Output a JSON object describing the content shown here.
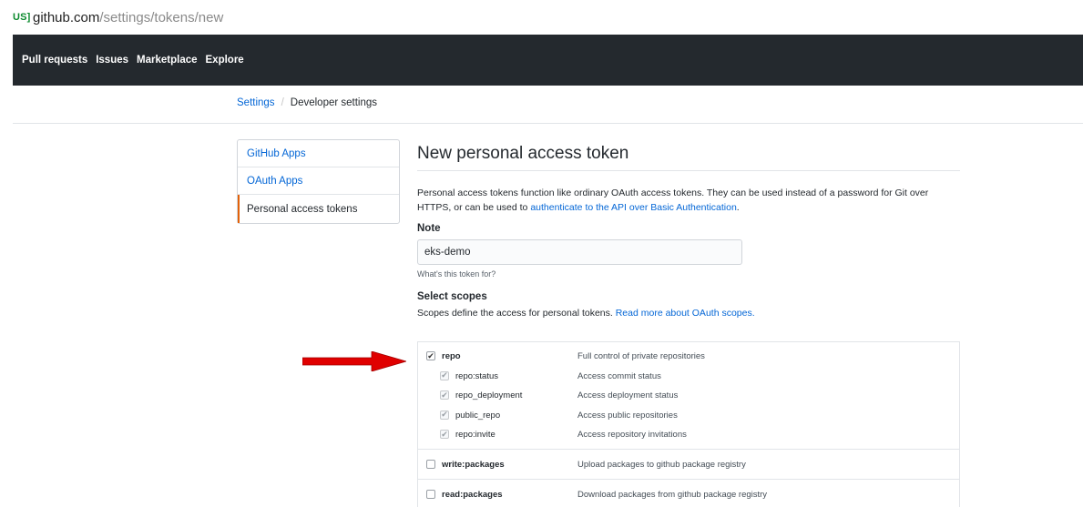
{
  "browser": {
    "secure_badge": "US]",
    "url_domain": "github.com",
    "url_path": "/settings/tokens/new"
  },
  "header": {
    "nav": [
      "Pull requests",
      "Issues",
      "Marketplace",
      "Explore"
    ]
  },
  "breadcrumb": {
    "settings": "Settings",
    "separator": "/",
    "current": "Developer settings"
  },
  "sidebar": {
    "items": [
      {
        "label": "GitHub Apps",
        "active": false
      },
      {
        "label": "OAuth Apps",
        "active": false
      },
      {
        "label": "Personal access tokens",
        "active": true
      }
    ]
  },
  "main": {
    "title": "New personal access token",
    "intro_text": "Personal access tokens function like ordinary OAuth access tokens. They can be used instead of a password for Git over HTTPS, or can be used to ",
    "intro_link": "authenticate to the API over Basic Authentication",
    "intro_end": ".",
    "note_label": "Note",
    "note_value": "eks-demo",
    "note_hint": "What's this token for?",
    "scopes_label": "Select scopes",
    "scopes_desc": "Scopes define the access for personal tokens. ",
    "scopes_link": "Read more about OAuth scopes."
  },
  "scopes": {
    "repo": {
      "name": "repo",
      "desc": "Full control of private repositories",
      "checked": true
    },
    "repo_children": [
      {
        "name": "repo:status",
        "desc": "Access commit status",
        "checked": true
      },
      {
        "name": "repo_deployment",
        "desc": "Access deployment status",
        "checked": true
      },
      {
        "name": "public_repo",
        "desc": "Access public repositories",
        "checked": true
      },
      {
        "name": "repo:invite",
        "desc": "Access repository invitations",
        "checked": true
      }
    ],
    "write_packages": {
      "name": "write:packages",
      "desc": "Upload packages to github package registry",
      "checked": false
    },
    "read_packages": {
      "name": "read:packages",
      "desc": "Download packages from github package registry",
      "checked": false
    }
  },
  "colors": {
    "header_bg": "#24292e",
    "link": "#0366d6",
    "active_menu_accent": "#e36209",
    "annotation_arrow": "#e00000"
  }
}
